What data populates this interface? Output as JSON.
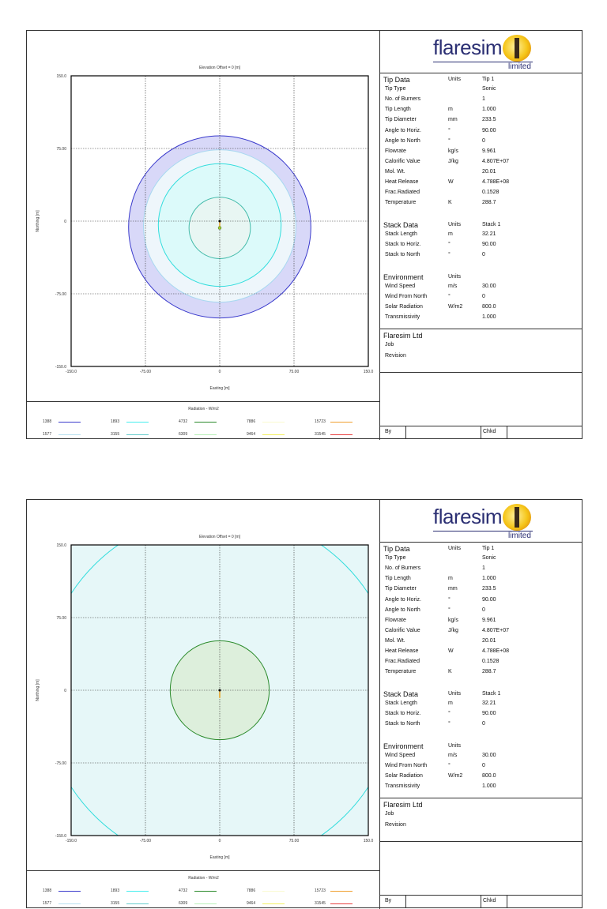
{
  "pages": [
    {
      "chart_data": {
        "type": "contour",
        "title": "Elevation Offset = 0 [m]",
        "xlabel": "Easting [m]",
        "ylabel": "Northing [m]",
        "xlim": [
          -150,
          150
        ],
        "ylim": [
          -150,
          150
        ],
        "xticks": [
          "-150.0",
          "-75.00",
          "0",
          "75.00",
          "150.0"
        ],
        "yticks": [
          "150.0",
          "75.00",
          "0",
          "-75.00",
          "-150.0"
        ],
        "grid": true,
        "contours": [
          {
            "level": 1388,
            "radius_m": 92,
            "cx": 0,
            "cy": -6,
            "stroke": "#3a3acc",
            "fill": "#d8d8f8"
          },
          {
            "level": 1577,
            "radius_m": 77,
            "cx": 0,
            "cy": -5,
            "stroke": "#a8d8f0",
            "fill": "#eef6fb"
          },
          {
            "level": 1893,
            "radius_m": 62,
            "cx": 0,
            "cy": -4,
            "stroke": "#33dddd",
            "fill": "#dcfafa"
          },
          {
            "level": 3155,
            "radius_m": 31,
            "cx": 0,
            "cy": -7,
            "stroke": "#44bbaa",
            "fill": "#e8f6f3"
          }
        ]
      }
    },
    {
      "chart_data": {
        "type": "contour",
        "title": "Elevation Offset = 0 [m]",
        "xlabel": "Easting [m]",
        "ylabel": "Northing [m]",
        "xlim": [
          -150,
          150
        ],
        "ylim": [
          -150,
          150
        ],
        "xticks": [
          "-150.0",
          "-75.00",
          "0",
          "75.00",
          "150.0"
        ],
        "yticks": [
          "150.0",
          "75.00",
          "0",
          "-75.00",
          "-150.0"
        ],
        "grid": true,
        "background_fill": "#e6f7f8",
        "contours": [
          {
            "level": 1893,
            "radius_m": 179,
            "cx": 0,
            "cy": 0,
            "stroke": "#33dddd",
            "fill": "#e6f7f8"
          },
          {
            "level": 4732,
            "radius_m": 50,
            "cx": 0,
            "cy": 0,
            "stroke": "#2a8a2a",
            "fill": "#ddefdc"
          }
        ]
      }
    }
  ],
  "legend": {
    "title": "Radiation - W/m2",
    "items": [
      {
        "label": "1388",
        "color": "#3a3acc"
      },
      {
        "label": "1577",
        "color": "#b8e0f0"
      },
      {
        "label": "1893",
        "color": "#44eeee"
      },
      {
        "label": "3155",
        "color": "#66cccc"
      },
      {
        "label": "4732",
        "color": "#2a8a2a"
      },
      {
        "label": "6309",
        "color": "#b8f0b8"
      },
      {
        "label": "7886",
        "color": "#fafad0"
      },
      {
        "label": "9464",
        "color": "#f4f060"
      },
      {
        "label": "15723",
        "color": "#f0a030"
      },
      {
        "label": "31545",
        "color": "#e84040"
      }
    ]
  },
  "logo": {
    "name": "flaresim",
    "sub": "limited"
  },
  "panel": {
    "sections": [
      {
        "title": "Tip Data",
        "units": "Units",
        "value": "Tip 1",
        "rows": [
          [
            "Tip Type",
            "",
            "Sonic"
          ],
          [
            "No. of Burners",
            "",
            "1"
          ],
          [
            "Tip Length",
            "m",
            "1.000"
          ],
          [
            "Tip Diameter",
            "mm",
            "233.5"
          ],
          [
            "Angle to Horiz.",
            "°",
            "90.00"
          ],
          [
            "Angle to North",
            "°",
            "0"
          ],
          [
            "Flowrate",
            "kg/s",
            "9.961"
          ],
          [
            "Calorific Value",
            "J/kg",
            "4.807E+07"
          ],
          [
            "Mol. Wt.",
            "",
            "20.01"
          ],
          [
            "Heat Release",
            "W",
            "4.788E+08"
          ],
          [
            "Frac.Radiated",
            "",
            "0.1528"
          ],
          [
            "Temperature",
            "K",
            "288.7"
          ]
        ]
      },
      {
        "title": "Stack Data",
        "units": "Units",
        "value": "Stack 1",
        "rows": [
          [
            "Stack Length",
            "m",
            "32.21"
          ],
          [
            "Stack to Horiz.",
            "°",
            "90.00"
          ],
          [
            "Stack to North",
            "°",
            "0"
          ]
        ]
      },
      {
        "title": "Environment",
        "units": "Units",
        "value": "",
        "rows": [
          [
            "Wind Speed",
            "m/s",
            "30.00"
          ],
          [
            "Wind From North",
            "°",
            "0"
          ],
          [
            "Solar Radiation",
            "W/m2",
            "800.0"
          ],
          [
            "Transmissivity",
            "",
            "1.000"
          ]
        ]
      }
    ],
    "company": "Flaresim Ltd",
    "job_label": "Job",
    "revision_label": "Revision",
    "by_label": "By",
    "chkd_label": "Chkd"
  }
}
